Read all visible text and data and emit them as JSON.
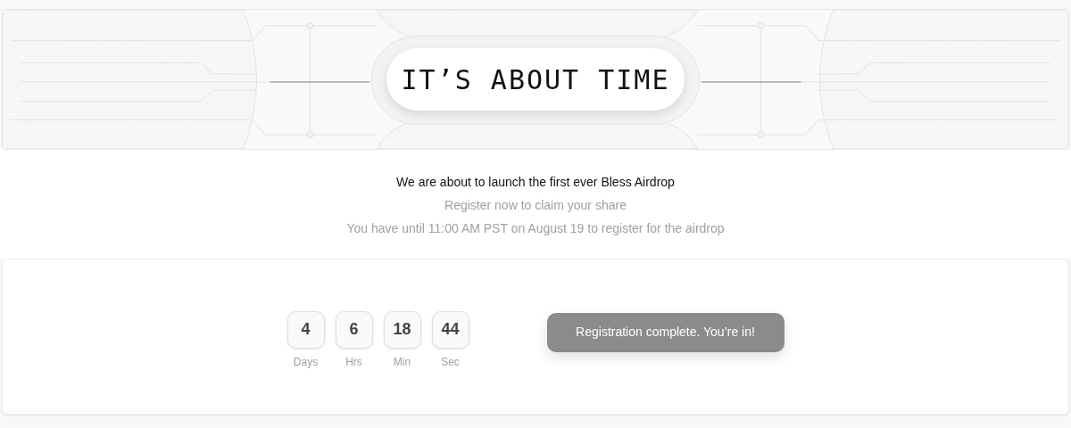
{
  "banner": {
    "title": "IT’S ABOUT TIME"
  },
  "intro": {
    "headline": "We are about to launch the first ever Bless Airdrop",
    "subline": "Register now to claim your share",
    "deadline": "You have until 11:00 AM PST on August 19 to register for the airdrop"
  },
  "countdown": [
    {
      "value": "4",
      "unit": "Days"
    },
    {
      "value": "6",
      "unit": "Hrs"
    },
    {
      "value": "18",
      "unit": "Min"
    },
    {
      "value": "44",
      "unit": "Sec"
    }
  ],
  "registration_button": {
    "label": "Registration complete. You’re in!",
    "disabled": true
  }
}
